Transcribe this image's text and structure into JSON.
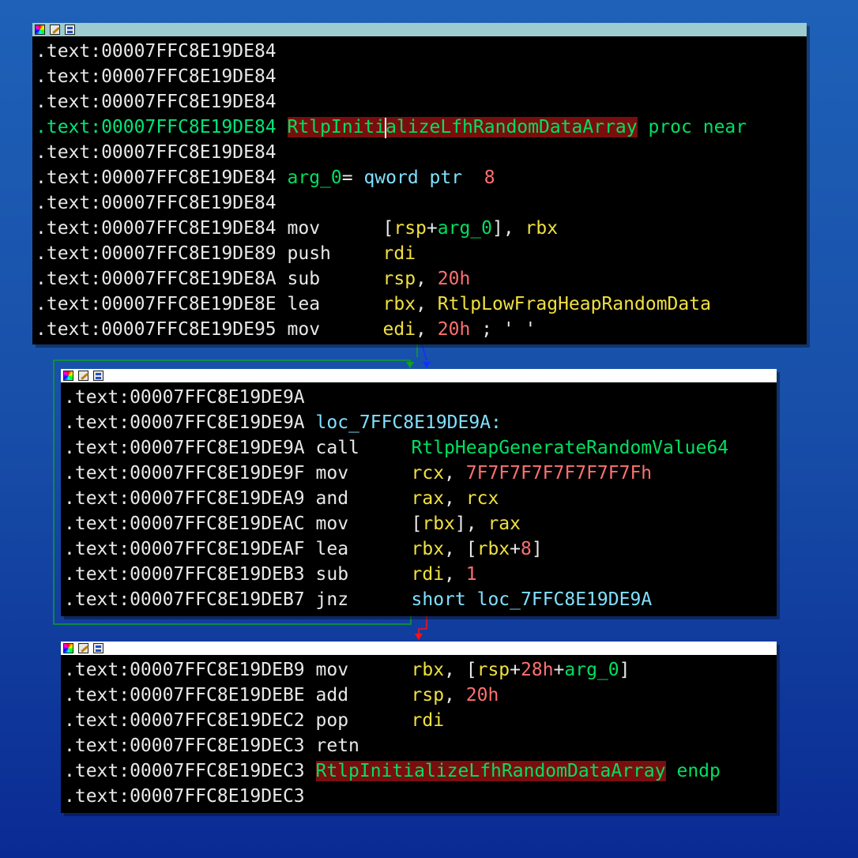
{
  "blocks": [
    {
      "lines": [
        {
          "addr": ".text:00007FFC8E19DE84"
        },
        {
          "addr": ".text:00007FFC8E19DE84"
        },
        {
          "addr": ".text:00007FFC8E19DE84"
        },
        {
          "addr": ".text:00007FFC8E19DE84",
          "func_a": "RtlpIniti",
          "func_b": "alizeLfhRandomDataArray",
          "suffix": "proc near"
        },
        {
          "addr": ".text:00007FFC8E19DE84"
        },
        {
          "addr": ".text:00007FFC8E19DE84",
          "label": "arg_0",
          "eq": "= ",
          "kw": "qword ptr",
          "num": "8"
        },
        {
          "addr": ".text:00007FFC8E19DE84"
        },
        {
          "addr": ".text:00007FFC8E19DE84",
          "mn": "mov",
          "op": "[rsp+arg_0], rbx"
        },
        {
          "addr": ".text:00007FFC8E19DE89",
          "mn": "push",
          "op": "rdi"
        },
        {
          "addr": ".text:00007FFC8E19DE8A",
          "mn": "sub",
          "op": "rsp, 20h"
        },
        {
          "addr": ".text:00007FFC8E19DE8E",
          "mn": "lea",
          "op": "rbx, RtlpLowFragHeapRandomData"
        },
        {
          "addr": ".text:00007FFC8E19DE95",
          "mn": "mov",
          "op": "edi, 20h ; ' '"
        }
      ]
    },
    {
      "lines": [
        {
          "addr": ".text:00007FFC8E19DE9A"
        },
        {
          "addr": ".text:00007FFC8E19DE9A",
          "loc": "loc_7FFC8E19DE9A:"
        },
        {
          "addr": ".text:00007FFC8E19DE9A",
          "mn": "call",
          "op": "RtlpHeapGenerateRandomValue64"
        },
        {
          "addr": ".text:00007FFC8E19DE9F",
          "mn": "mov",
          "op": "rcx, 7F7F7F7F7F7F7F7Fh"
        },
        {
          "addr": ".text:00007FFC8E19DEA9",
          "mn": "and",
          "op": "rax, rcx"
        },
        {
          "addr": ".text:00007FFC8E19DEAC",
          "mn": "mov",
          "op": "[rbx], rax"
        },
        {
          "addr": ".text:00007FFC8E19DEAF",
          "mn": "lea",
          "op": "rbx, [rbx+8]"
        },
        {
          "addr": ".text:00007FFC8E19DEB3",
          "mn": "sub",
          "op": "rdi, 1"
        },
        {
          "addr": ".text:00007FFC8E19DEB7",
          "mn": "jnz",
          "op": "short loc_7FFC8E19DE9A"
        }
      ]
    },
    {
      "lines": [
        {
          "addr": ".text:00007FFC8E19DEB9",
          "mn": "mov",
          "op": "rbx, [rsp+28h+arg_0]"
        },
        {
          "addr": ".text:00007FFC8E19DEBE",
          "mn": "add",
          "op": "rsp, 20h"
        },
        {
          "addr": ".text:00007FFC8E19DEC2",
          "mn": "pop",
          "op": "rdi"
        },
        {
          "addr": ".text:00007FFC8E19DEC3",
          "mn": "retn"
        },
        {
          "addr": ".text:00007FFC8E19DEC3",
          "func": "RtlpInitializeLfhRandomDataArray",
          "suffix": "endp"
        },
        {
          "addr": ".text:00007FFC8E19DEC3"
        }
      ]
    }
  ],
  "icons": [
    "palette-icon",
    "edit-icon",
    "graph-icon"
  ],
  "colors": {
    "background_top": "#1f61b8",
    "background_bottom": "#0a2a93",
    "code_bg": "#000000",
    "address": "#e8e8e8",
    "label_green": "#00e060",
    "register_yellow": "#f0e040",
    "number_red": "#ff7070",
    "keyword_cyan": "#80e0ff",
    "function_highlight": "#7a0e0e",
    "edge_green": "#10a020",
    "edge_blue": "#1030ff",
    "edge_red": "#ff1010"
  }
}
